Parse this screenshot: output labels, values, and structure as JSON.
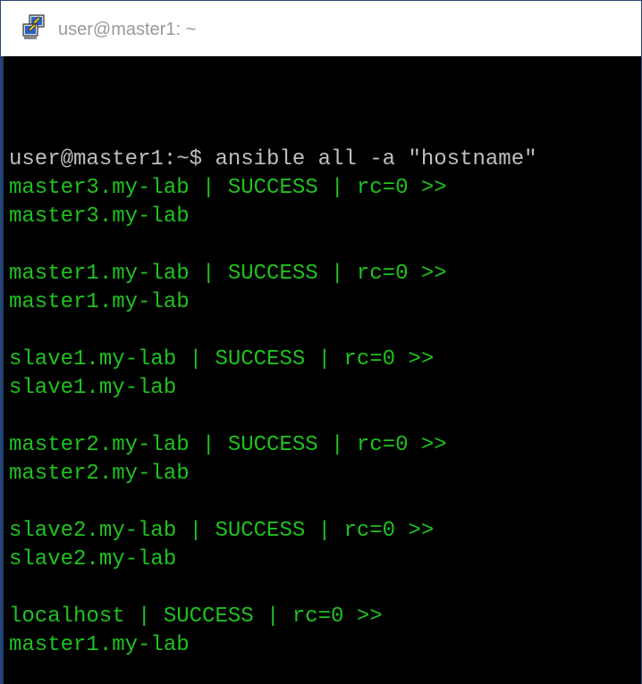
{
  "window": {
    "title": "user@master1: ~",
    "icon": "putty-icon"
  },
  "colors": {
    "background": "#000000",
    "prompt_text": "#bfbfbf",
    "output_text": "#1fc21f",
    "cursor": "#22d622"
  },
  "terminal": {
    "lines": [
      {
        "text": "user@master1:~$ ansible all -a \"hostname\"",
        "kind": "command"
      },
      {
        "text": "master3.my-lab | SUCCESS | rc=0 >>",
        "kind": "output"
      },
      {
        "text": "master3.my-lab",
        "kind": "output"
      },
      {
        "text": "",
        "kind": "output"
      },
      {
        "text": "master1.my-lab | SUCCESS | rc=0 >>",
        "kind": "output"
      },
      {
        "text": "master1.my-lab",
        "kind": "output"
      },
      {
        "text": "",
        "kind": "output"
      },
      {
        "text": "slave1.my-lab | SUCCESS | rc=0 >>",
        "kind": "output"
      },
      {
        "text": "slave1.my-lab",
        "kind": "output"
      },
      {
        "text": "",
        "kind": "output"
      },
      {
        "text": "master2.my-lab | SUCCESS | rc=0 >>",
        "kind": "output"
      },
      {
        "text": "master2.my-lab",
        "kind": "output"
      },
      {
        "text": "",
        "kind": "output"
      },
      {
        "text": "slave2.my-lab | SUCCESS | rc=0 >>",
        "kind": "output"
      },
      {
        "text": "slave2.my-lab",
        "kind": "output"
      },
      {
        "text": "",
        "kind": "output"
      },
      {
        "text": "localhost | SUCCESS | rc=0 >>",
        "kind": "output"
      },
      {
        "text": "master1.my-lab",
        "kind": "output"
      },
      {
        "text": "",
        "kind": "output"
      }
    ],
    "prompt": "user@master1:~$ "
  }
}
